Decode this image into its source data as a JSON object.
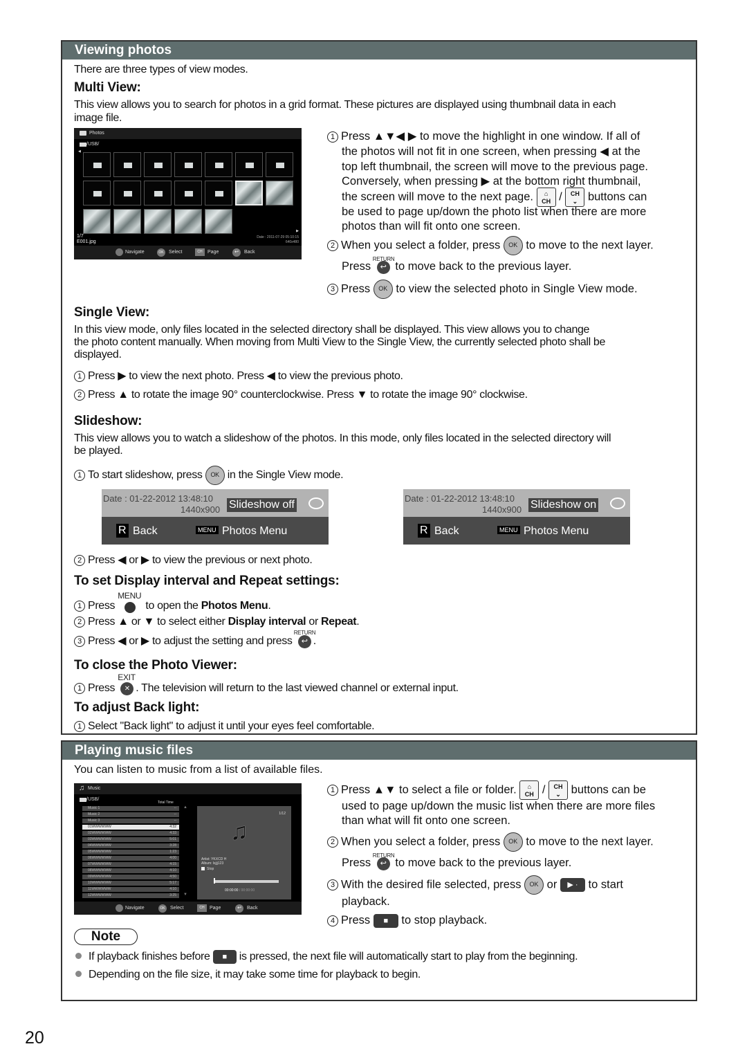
{
  "page_number": "20",
  "viewing_photos": {
    "header": "Viewing photos",
    "intro": "There are three types of view modes.",
    "multi_view": {
      "title": "Multi View:",
      "desc_line1": "This view allows you to search for photos in a grid format. These pictures are displayed using thumbnail data in each",
      "desc_line2": "image file.",
      "screen": {
        "title": "Photos",
        "path": "/USB/",
        "page": "1/7",
        "filename": "E001.jpg",
        "date": "Date : 2011-07-29 05:10:15",
        "resolution": "640x480",
        "nav": [
          {
            "icon": "navigate-icon",
            "label": "Navigate"
          },
          {
            "icon": "ok-icon",
            "glyph": "OK",
            "label": "Select"
          },
          {
            "icon": "ch-page-icon",
            "glyph": "CH",
            "label": "Page"
          },
          {
            "icon": "back-icon",
            "glyph": "↩",
            "label": "Back"
          }
        ]
      },
      "steps": {
        "s1_l1": "Press ▲▼◀ ▶ to move the highlight in one window. If all of",
        "s1_l2": "the photos will not fit in one screen, when pressing ◀ at the",
        "s1_l3": "top left thumbnail, the screen will move to the previous page.",
        "s1_l4": "Conversely, when pressing ▶ at the bottom right thumbnail,",
        "s1_l5a": "the screen will move to the next page.",
        "s1_l5b": "buttons can",
        "s1_l6": "be used to page up/down the photo list when there are more",
        "s1_l7": "photos than will fit onto one screen.",
        "s2_l1a": "When you select a folder, press",
        "s2_l1b": "to move to the next layer.",
        "s2_l2a": "Press",
        "s2_l2b": "to move back to the previous layer.",
        "s3a": "Press",
        "s3b": "to view the selected photo in Single View mode."
      }
    },
    "single_view": {
      "title": "Single View:",
      "desc_line1": "In this view mode, only files located in the selected directory shall be displayed. This view allows you to change",
      "desc_line2": "the photo content manually. When moving from Multi View to the Single View, the currently selected photo shall be",
      "desc_line3": "displayed.",
      "step1": "Press ▶ to view the next photo. Press ◀ to view the previous photo.",
      "step2": "Press ▲ to rotate the image 90° counterclockwise. Press ▼ to rotate the image 90° clockwise."
    },
    "slideshow": {
      "title": "Slideshow:",
      "desc_line1": "This view allows you to watch a slideshow of the photos. In this mode, only files located in the selected directory will",
      "desc_line2": "be played.",
      "step1a": "To start slideshow, press",
      "step1b": "in the Single View mode.",
      "panels": [
        {
          "date": "Date : 01-22-2012 13:48:10",
          "resolution": "1440x900",
          "status": "Slideshow off",
          "back_key": "R",
          "back_label": "Back",
          "menu_key": "MENU",
          "menu_label": "Photos Menu"
        },
        {
          "date": "Date : 01-22-2012 13:48:10",
          "resolution": "1440x900",
          "status": "Slideshow on",
          "back_key": "R",
          "back_label": "Back",
          "menu_key": "MENU",
          "menu_label": "Photos Menu"
        }
      ],
      "step2": "Press ◀ or ▶ to view the previous or next photo."
    },
    "display_interval": {
      "title": "To set Display interval and Repeat settings:",
      "s1a": "Press",
      "s1b": "to open the",
      "s1c": "Photos Menu",
      "s2a": "Press ▲ or ▼ to select either",
      "s2b": "Display interval",
      "s2c": "or",
      "s2d": "Repeat",
      "s3a": "Press ◀ or ▶ to adjust the setting and press"
    },
    "close_viewer": {
      "title": "To close the Photo Viewer:",
      "s1a": "Press",
      "s1b": ". The television will return to the last viewed channel or external input."
    },
    "back_light": {
      "title": "To adjust Back light:",
      "s1": "Select \"Back light\" to adjust it until your eyes feel comfortable."
    }
  },
  "playing_music": {
    "header": "Playing music files",
    "intro": "You can listen to music from a list of available files.",
    "screen": {
      "title": "Music",
      "path": "/USB/",
      "total_time_label": "Total Time",
      "tracks": [
        {
          "name": "Music 1",
          "time": "--"
        },
        {
          "name": "Music 2",
          "time": "--"
        },
        {
          "name": "Music 3",
          "time": "--"
        },
        {
          "name": "01WWWWWW",
          "time": "4:32"
        },
        {
          "name": "02WWWWWW",
          "time": "4:33"
        },
        {
          "name": "03WWWWWW",
          "time": "5:01"
        },
        {
          "name": "04WWWWWW",
          "time": "3:28"
        },
        {
          "name": "05WWWWWW",
          "time": "1:23"
        },
        {
          "name": "06WWWWWW",
          "time": "4:00"
        },
        {
          "name": "07WWWWWW",
          "time": "4:15"
        },
        {
          "name": "08WWWWWW",
          "time": "4:10"
        },
        {
          "name": "09WWWWWW",
          "time": "4:50"
        },
        {
          "name": "10WWWWWW",
          "time": "5:17"
        },
        {
          "name": "11WWWWWW",
          "time": "4:10"
        },
        {
          "name": "12WWWWWW",
          "time": "3:25"
        }
      ],
      "selected_index": 3,
      "counter": "1/12",
      "artist": "Artist:  YKXCD H",
      "album": "Album:  lsjjj123",
      "status": "Stop",
      "progress": 0,
      "time": "00:00:00",
      "duration": "/ 00:00:00",
      "nav": [
        {
          "icon": "navigate-icon",
          "label": "Navigate"
        },
        {
          "icon": "ok-icon",
          "glyph": "OK",
          "label": "Select"
        },
        {
          "icon": "ch-page-icon",
          "glyph": "CH",
          "label": "Page"
        },
        {
          "icon": "back-icon",
          "glyph": "↩",
          "label": "Back"
        }
      ]
    },
    "steps": {
      "s1_l1a": "Press ▲▼ to select a file or folder.",
      "s1_l1b": "buttons can be",
      "s1_l2": "used to page up/down the music list when there are more files",
      "s1_l3": "than what will fit onto one screen.",
      "s2_l1a": "When you select a folder, press",
      "s2_l1b": "to move to the next layer.",
      "s2_l2a": "Press",
      "s2_l2b": "to move back to the previous layer.",
      "s3_l1a": "With the desired file selected, press",
      "s3_l1b": "or",
      "s3_l1c": "to start",
      "s3_l2": "playback.",
      "s4a": "Press",
      "s4b": "to stop playback."
    },
    "note": {
      "label": "Note",
      "item1a": "If playback finishes before",
      "item1b": "is pressed, the next file will automatically start to play from the beginning.",
      "item2": "Depending on the file size, it may take some time for playback to begin."
    }
  },
  "buttons": {
    "ok": "OK",
    "return_cap": "RETURN",
    "menu_cap": "MENU",
    "exit_cap": "EXIT",
    "ch": "CH",
    "num1": "1",
    "num2": "2",
    "num3": "3",
    "num4": "4"
  }
}
